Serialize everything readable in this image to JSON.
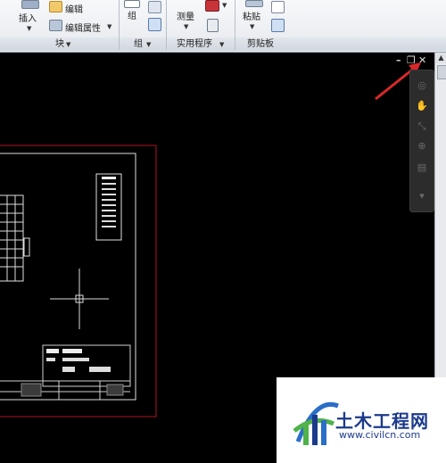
{
  "ribbon": {
    "block_panel": {
      "title": "块",
      "insert_label": "插入",
      "edit_label": "编辑",
      "edit_attributes_label": "编辑属性"
    },
    "group_panel": {
      "title": "组",
      "group_label": "组"
    },
    "utilities_panel": {
      "title": "实用程序",
      "measure_label": "测量"
    },
    "clipboard_panel": {
      "title": "剪贴板",
      "paste_label": "粘贴"
    }
  },
  "window_controls": {
    "minimize": "–",
    "restore": "❐",
    "close": "✕"
  },
  "watermark": {
    "title": "土木工程网",
    "url": "www.civilcn.com"
  },
  "colors": {
    "accent_arrow": "#d9282a",
    "border_red": "#b01325",
    "watermark_blue": "#1b3a8a"
  }
}
